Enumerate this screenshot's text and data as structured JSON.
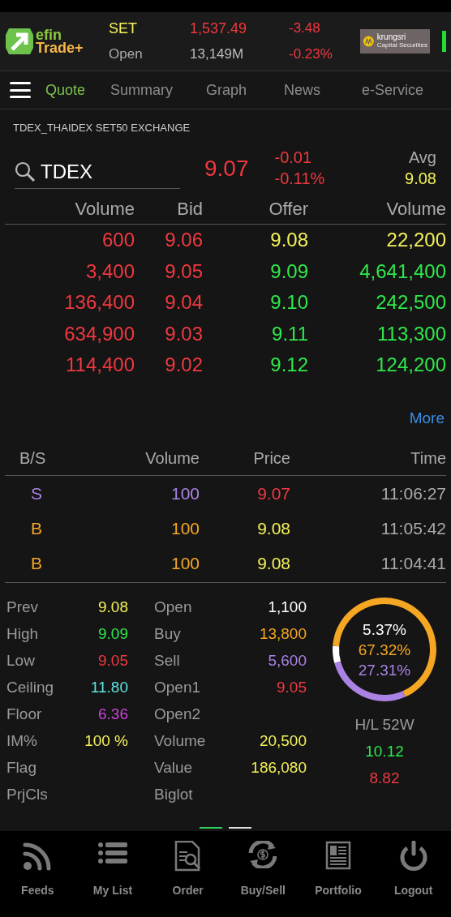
{
  "header": {
    "logo": {
      "top": "efin",
      "bottom": "Trade+"
    },
    "index_name": "SET",
    "index_value": "1,537.49",
    "index_change": "-3.48",
    "market_state": "Open",
    "market_value": "13,149M",
    "index_change_pct": "-0.23%",
    "broker": {
      "name": "krungsri",
      "subtitle": "Capital Securities"
    }
  },
  "tabs": [
    {
      "label": "Quote",
      "selected": true
    },
    {
      "label": "Summary",
      "selected": false
    },
    {
      "label": "Graph",
      "selected": false
    },
    {
      "label": "News",
      "selected": false
    },
    {
      "label": "e-Service",
      "selected": false
    }
  ],
  "instrument": "TDEX_THAIDEX SET50 EXCHANGE",
  "quote": {
    "symbol": "TDEX",
    "last": "9.07",
    "change": "-0.01",
    "change_pct": "-0.11%",
    "avg_label": "Avg",
    "avg": "9.08"
  },
  "book": {
    "columns": [
      "Volume",
      "Bid",
      "Offer",
      "Volume"
    ],
    "rows": [
      [
        {
          "text": "600",
          "color": "#f0383f"
        },
        {
          "text": "9.06",
          "color": "#f0383f"
        },
        {
          "text": "9.08",
          "color": "#f4f158"
        },
        {
          "text": "22,200",
          "color": "#f4f158"
        }
      ],
      [
        {
          "text": "3,400",
          "color": "#f0383f"
        },
        {
          "text": "9.05",
          "color": "#f0383f"
        },
        {
          "text": "9.09",
          "color": "#2fe84b"
        },
        {
          "text": "4,641,400",
          "color": "#2fe84b"
        }
      ],
      [
        {
          "text": "136,400",
          "color": "#f0383f"
        },
        {
          "text": "9.04",
          "color": "#f0383f"
        },
        {
          "text": "9.10",
          "color": "#2fe84b"
        },
        {
          "text": "242,500",
          "color": "#2fe84b"
        }
      ],
      [
        {
          "text": "634,900",
          "color": "#f0383f"
        },
        {
          "text": "9.03",
          "color": "#f0383f"
        },
        {
          "text": "9.11",
          "color": "#2fe84b"
        },
        {
          "text": "113,300",
          "color": "#2fe84b"
        }
      ],
      [
        {
          "text": "114,400",
          "color": "#f0383f"
        },
        {
          "text": "9.02",
          "color": "#f0383f"
        },
        {
          "text": "9.12",
          "color": "#2fe84b"
        },
        {
          "text": "124,200",
          "color": "#2fe84b"
        }
      ]
    ],
    "more": "More"
  },
  "trades": {
    "columns": [
      "B/S",
      "Volume",
      "Price",
      "Time"
    ],
    "rows": [
      [
        {
          "text": "S",
          "color": "#a982e3"
        },
        {
          "text": "100",
          "color": "#a982e3"
        },
        {
          "text": "9.07",
          "color": "#f0383f"
        },
        {
          "text": "11:06:27",
          "color": "#aaaaaa"
        }
      ],
      [
        {
          "text": "B",
          "color": "#f5a623"
        },
        {
          "text": "100",
          "color": "#f5a623"
        },
        {
          "text": "9.08",
          "color": "#f4f158"
        },
        {
          "text": "11:05:42",
          "color": "#aaaaaa"
        }
      ],
      [
        {
          "text": "B",
          "color": "#f5a623"
        },
        {
          "text": "100",
          "color": "#f5a623"
        },
        {
          "text": "9.08",
          "color": "#f4f158"
        },
        {
          "text": "11:04:41",
          "color": "#aaaaaa"
        }
      ]
    ]
  },
  "stats_left": [
    {
      "label": "Prev",
      "value": "9.08",
      "color": "#f4f158"
    },
    {
      "label": "High",
      "value": "9.09",
      "color": "#2fe84b"
    },
    {
      "label": "Low",
      "value": "9.05",
      "color": "#f0383f"
    },
    {
      "label": "Ceiling",
      "value": "11.80",
      "color": "#5fe3e0"
    },
    {
      "label": "Floor",
      "value": "6.36",
      "color": "#c945d6"
    },
    {
      "label": "IM%",
      "value": "100 %",
      "color": "#f4f158"
    },
    {
      "label": "Flag"
    },
    {
      "label": "PrjCls"
    }
  ],
  "stats_mid": [
    {
      "label": "Open",
      "value": "1,100",
      "color": "#ffffff"
    },
    {
      "label": "Buy",
      "value": "13,800",
      "color": "#f5a623"
    },
    {
      "label": "Sell",
      "value": "5,600",
      "color": "#a982e3"
    },
    {
      "label": "Open1",
      "value": "9.05",
      "color": "#f0383f"
    },
    {
      "label": "Open2"
    },
    {
      "label": "Volume",
      "value": "20,500",
      "color": "#f4f158"
    },
    {
      "label": "Value",
      "value": "186,080",
      "color": "#f4f158"
    },
    {
      "label": "Biglot"
    }
  ],
  "ratio": {
    "chart_data": {
      "type": "donut",
      "series": [
        {
          "values": [
            5.37,
            67.32,
            27.31
          ]
        }
      ],
      "value_labels": [
        "5.37%",
        "67.32%",
        "27.31%"
      ]
    }
  },
  "hl52w": {
    "label": "H/L 52W",
    "high": "10.12",
    "low": "8.82"
  },
  "pages": [
    {
      "selected": true
    },
    {
      "selected": false
    }
  ],
  "nav": [
    {
      "label": "Feeds",
      "kind": "feeds"
    },
    {
      "label": "My List",
      "kind": "list"
    },
    {
      "label": "Order",
      "kind": "order"
    },
    {
      "label": "Buy/Sell",
      "kind": "exchange"
    },
    {
      "label": "Portfolio",
      "kind": "portfolio"
    },
    {
      "label": "Logout",
      "kind": "logout"
    }
  ]
}
